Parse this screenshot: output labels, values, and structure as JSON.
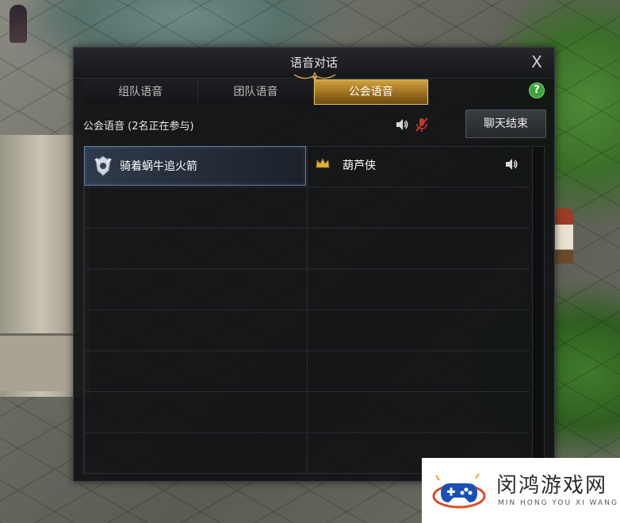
{
  "window": {
    "title": "语音对话"
  },
  "tabs": [
    {
      "label": "组队语音",
      "active": false
    },
    {
      "label": "团队语音",
      "active": false
    },
    {
      "label": "公会语音",
      "active": true
    }
  ],
  "help_label": "?",
  "close_label": "X",
  "channel": {
    "status": "公会语音 (2名正在参与)",
    "end_button": "聊天结束"
  },
  "members": [
    {
      "name": "骑着蜗牛追火箭",
      "icon": "guild-rank-emblem-icon",
      "selected": true
    },
    {
      "name": "葫芦侠",
      "icon": "crown-icon",
      "speaker": "speaker-icon",
      "selected": false
    }
  ],
  "colors": {
    "accent_gold": "#d4a440",
    "help_green": "#3fa33a",
    "muted_red": "#c0392b",
    "selected_border": "#5f7aa0"
  },
  "watermark": {
    "cn": "闵鸿游戏网",
    "en": "MIN HONG YOU XI WANG"
  }
}
